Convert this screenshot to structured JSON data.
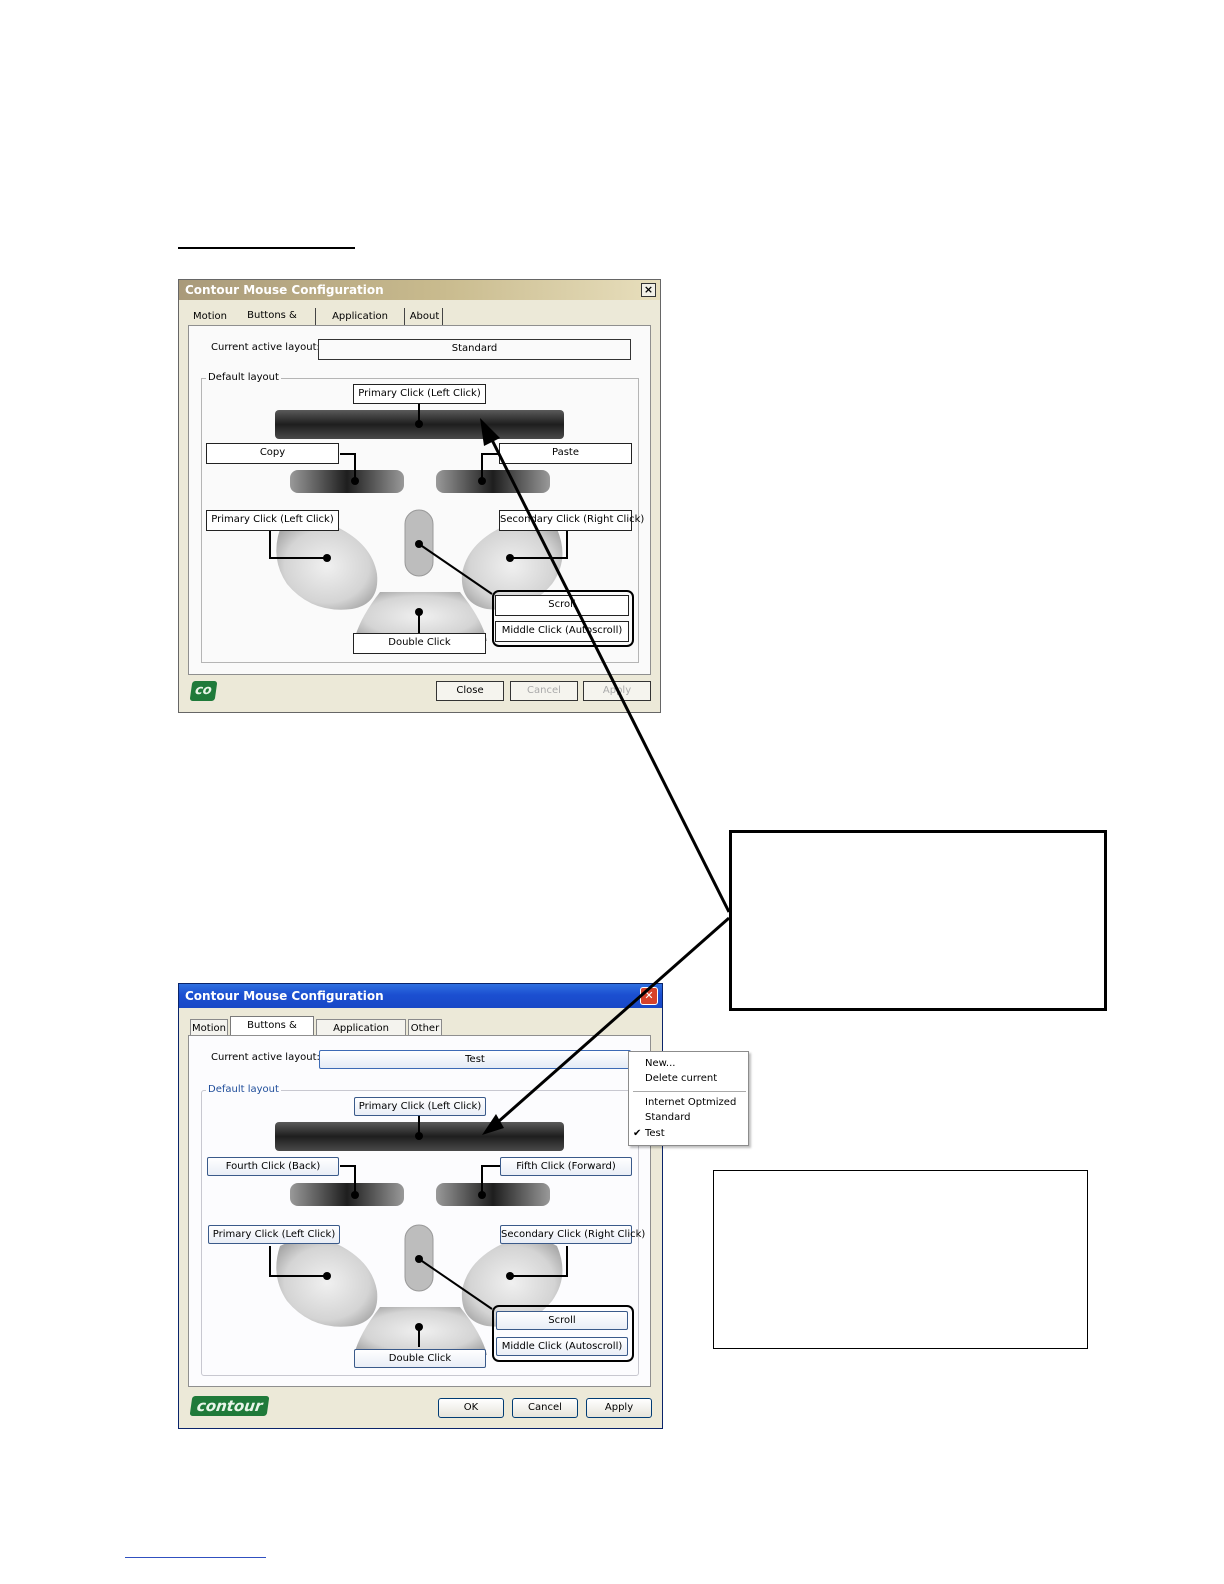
{
  "page": {
    "bottom_link_text": ""
  },
  "dialog1": {
    "title": "Contour Mouse Configuration",
    "close_glyph": "×",
    "tabs": [
      {
        "label": "Motion"
      },
      {
        "label": "Buttons & Wheel",
        "active": true
      },
      {
        "label": "Application specific"
      },
      {
        "label": "About"
      }
    ],
    "current_layout_label": "Current active layout:",
    "current_layout_value": "Standard",
    "group_label": "Default layout",
    "buttons": {
      "top": "Primary Click (Left Click)",
      "left_small": "Copy",
      "right_small": "Paste",
      "left_main": "Primary Click (Left Click)",
      "right_main": "Secondary Click (Right Click)",
      "scroll": "Scroll",
      "middle": "Middle Click (Autoscroll)",
      "bottom": "Double Click"
    },
    "logo": "co",
    "footer_buttons": [
      "Close",
      "Cancel",
      "Apply"
    ]
  },
  "dialog2": {
    "title": "Contour Mouse Configuration",
    "close_glyph": "✕",
    "tabs": [
      {
        "label": "Motion"
      },
      {
        "label": "Buttons & Wheel",
        "active": true
      },
      {
        "label": "Application specific"
      },
      {
        "label": "Other"
      }
    ],
    "current_layout_label": "Current active layout:",
    "current_layout_value": "Test",
    "group_label": "Default layout",
    "buttons": {
      "top": "Primary Click (Left Click)",
      "left_small": "Fourth Click (Back)",
      "right_small": "Fifth Click (Forward)",
      "left_main": "Primary Click (Left Click)",
      "right_main": "Secondary Click (Right Click)",
      "scroll": "Scroll",
      "middle": "Middle Click (Autoscroll)",
      "bottom": "Double Click"
    },
    "logo": "contour",
    "footer_buttons": [
      "OK",
      "Cancel",
      "Apply"
    ]
  },
  "context_menu": {
    "items": [
      "New...",
      "Delete current"
    ],
    "layouts": [
      "Internet Optmized",
      "Standard",
      "Test"
    ],
    "checked": "Test",
    "check_glyph": "✔"
  },
  "colors": {
    "title1": "#c9bb8e",
    "title2": "#1b4fd1",
    "logo_green": "#1f7a3a",
    "callout_border": "#000000"
  }
}
